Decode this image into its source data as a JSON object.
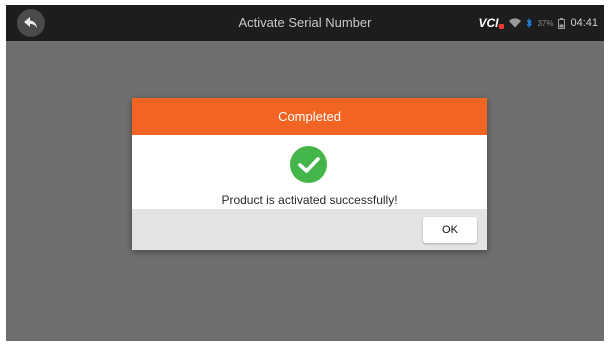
{
  "topbar": {
    "title": "Activate Serial Number",
    "back_icon": "back-arrow-icon",
    "status": {
      "vci_label": "VCI",
      "wifi_icon": "wifi-icon",
      "bluetooth_icon": "bluetooth-icon",
      "battery_percent": "37%",
      "battery_icon": "battery-icon",
      "time": "04:41"
    }
  },
  "dialog": {
    "title": "Completed",
    "icon": "success-check-icon",
    "message": "Product is activated successfully!",
    "ok_label": "OK"
  },
  "colors": {
    "header_orange": "#f26422",
    "success_green": "#43b549",
    "backdrop_gray": "#6e6e6e",
    "topbar_dark": "#1d1d1f"
  }
}
